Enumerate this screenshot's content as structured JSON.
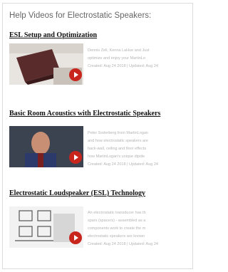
{
  "header": {
    "title": "Help Videos for Electrostatic Speakers:"
  },
  "videos": [
    {
      "title": "ESL Setup and Optimization",
      "description": [
        "Dennis Zell, Kenna LaHue and Just",
        "optimize and enjoy your MartinLo"
      ],
      "meta": "Created: Aug 24 2018 | Updated: Aug 24"
    },
    {
      "title": "Basic Room Acoustics with Electrostatic Speakers",
      "description": [
        "Peter Soderberg from MartinLogan",
        "and how electrostatic speakers are",
        "back-wall, ceiling and floor effects",
        "how MartinLogan's unique dipole"
      ],
      "meta": "Created: Aug 24 2018 | Updated: Aug 24"
    },
    {
      "title": "Electrostatic Loudspeaker (ESL) Technology",
      "description": [
        "An electrostatic transducer has th",
        "spars (spacers) - assembled as a",
        "components work to create the m",
        "electrostatic speakers are known"
      ],
      "meta": "Created: Aug 24 2018 | Updated: Aug 24"
    }
  ],
  "icons": {
    "play": "play-icon"
  },
  "colors": {
    "play_button": "#c8261d",
    "title_text": "#111111",
    "header_text": "#666666",
    "description_text": "#b4b4b4"
  }
}
